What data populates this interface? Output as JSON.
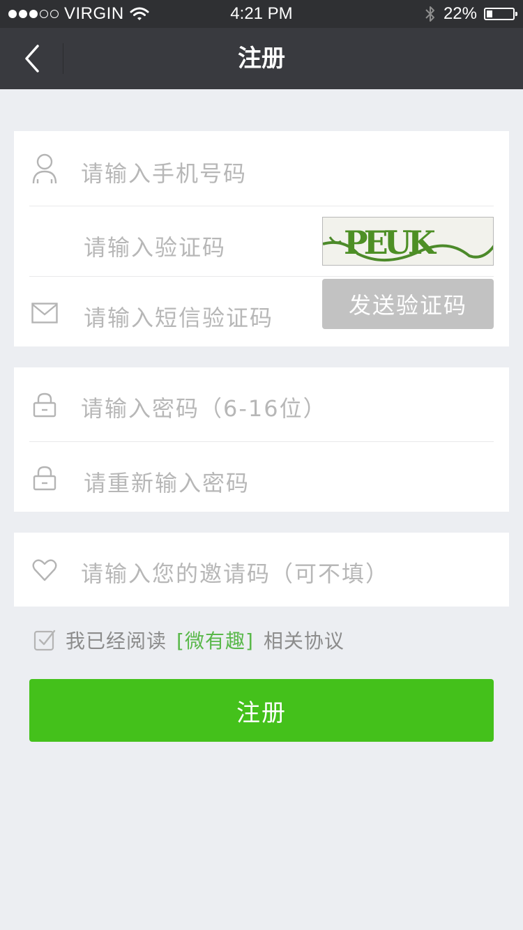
{
  "status_bar": {
    "carrier": "VIRGIN",
    "time": "4:21 PM",
    "battery": "22%",
    "battery_level": 0.22
  },
  "nav": {
    "title": "注册",
    "back_icon": "chevron-left-icon"
  },
  "form": {
    "phone_placeholder": "请输入手机号码",
    "captcha_placeholder": "请输入验证码",
    "captcha_text": "PEUK",
    "sms_placeholder": "请输入短信验证码",
    "send_code_label": "发送验证码",
    "password_placeholder": "请输入密码（6-16位）",
    "repeat_password_placeholder": "请重新输入密码",
    "invite_placeholder": "请输入您的邀请码（可不填）"
  },
  "agreement": {
    "prefix": "我已经阅读",
    "link": "[微有趣]",
    "suffix": "相关协议",
    "checked": true
  },
  "submit": {
    "label": "注册"
  },
  "colors": {
    "nav_bg": "#393a3f",
    "status_bg": "#2f3033",
    "primary_green": "#44c11b",
    "link_green": "#59b84a",
    "page_bg": "#eceef2",
    "disabled_button": "#c2c2c2"
  }
}
